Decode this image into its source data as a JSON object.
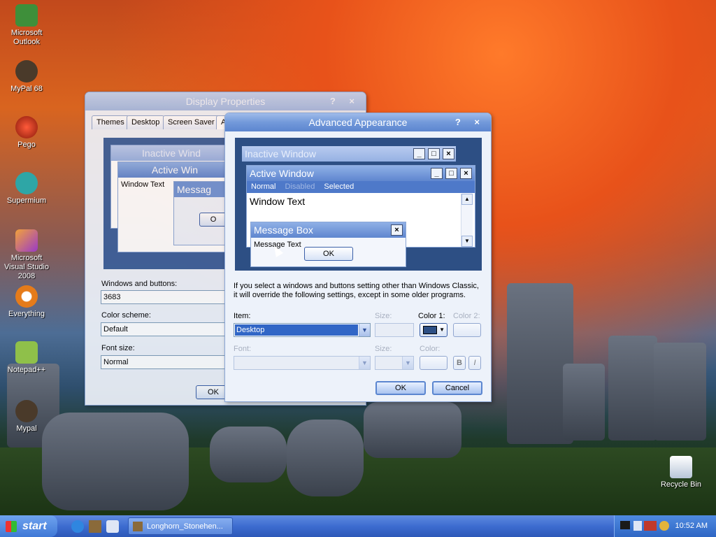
{
  "desktop": {
    "icons": [
      {
        "label": "Microsoft Outlook",
        "icon": "outlook-icon",
        "color": "#3e8f3a"
      },
      {
        "label": "MyPal 68",
        "icon": "mypal-icon",
        "color": "#4a3a2a"
      },
      {
        "label": "Pego",
        "icon": "pego-icon",
        "color": "#c62a1a"
      },
      {
        "label": "Supermium",
        "icon": "supermium-icon",
        "color": "#2ea6a6"
      },
      {
        "label": "Microsoft Visual Studio 2008",
        "icon": "visual-studio-icon",
        "color": "#d0622a"
      },
      {
        "label": "Everything",
        "icon": "everything-icon",
        "color": "#e57b1a"
      },
      {
        "label": "Notepad++",
        "icon": "notepadpp-icon",
        "color": "#8fc04a"
      },
      {
        "label": "Mypal",
        "icon": "mypal-icon",
        "color": "#4a3a2a"
      },
      {
        "label": "Recycle Bin",
        "icon": "recycle-bin-icon",
        "color": "#e8eef6"
      }
    ]
  },
  "display_properties": {
    "title": "Display Properties",
    "title_buttons": "? ×",
    "tabs": [
      "Themes",
      "Desktop",
      "Screen Saver",
      "A"
    ],
    "preview": {
      "inactive_title": "Inactive Wind",
      "active_title": "Active Win",
      "window_text": "Window Text",
      "message_title": "Messag",
      "ok_fragment": "O"
    },
    "windows_buttons_label": "Windows and buttons:",
    "windows_buttons_value": "3683",
    "color_scheme_label": "Color scheme:",
    "color_scheme_value": "Default",
    "font_size_label": "Font size:",
    "font_size_value": "Normal",
    "ok_fragment": "OK"
  },
  "advanced_appearance": {
    "title": "Advanced Appearance",
    "title_buttons": "? ×",
    "preview": {
      "inactive_title": "Inactive Window",
      "active_title": "Active Window",
      "menu_normal": "Normal",
      "menu_disabled": "Disabled",
      "menu_selected": "Selected",
      "window_text": "Window Text",
      "message_box_title": "Message Box",
      "message_text": "Message Text",
      "ok": "OK"
    },
    "info_text_line1": "If you select a windows and buttons setting other than Windows Classic,",
    "info_text_line2": "it will override the following settings, except in some older programs.",
    "item_label": "Item:",
    "item_value": "Desktop",
    "size_label": "Size:",
    "color1_label": "Color 1:",
    "color2_label": "Color 2:",
    "font_label": "Font:",
    "size2_label": "Size:",
    "color_label": "Color:",
    "bold_label": "B",
    "italic_label": "I",
    "ok_button": "OK",
    "cancel_button": "Cancel",
    "color1_swatch": "#2d4f84"
  },
  "taskbar": {
    "start_label": "start",
    "task_item": "Longhorn_Stonehen...",
    "clock": "10:52 AM",
    "quicklaunch": [
      "ie-icon",
      "home-icon",
      "window-switch-icon"
    ]
  }
}
